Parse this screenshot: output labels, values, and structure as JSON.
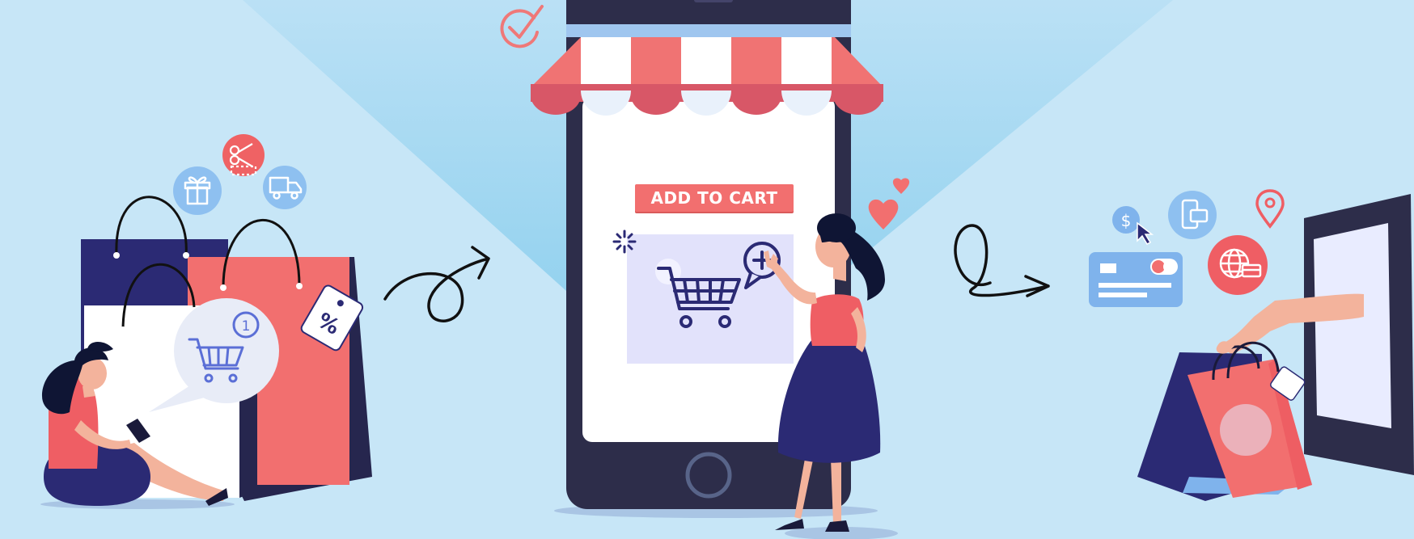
{
  "cta": {
    "label": "ADD TO CART"
  },
  "badges": {
    "notification_count": "1",
    "discount_symbol": "%",
    "currency_symbol": "$"
  },
  "colors": {
    "background": "#c7e6f7",
    "navy": "#2b2a74",
    "coral": "#f26f6f",
    "phone_frame": "#2d2d4a",
    "light_blue": "#7fb3ec"
  },
  "icons": [
    "check-circle-icon",
    "gift-icon",
    "coupon-icon",
    "truck-icon",
    "cart-icon",
    "heart-icon",
    "credit-card-icon",
    "globe-icon",
    "location-pin-icon",
    "mobile-payment-icon",
    "dollar-coin-icon"
  ]
}
